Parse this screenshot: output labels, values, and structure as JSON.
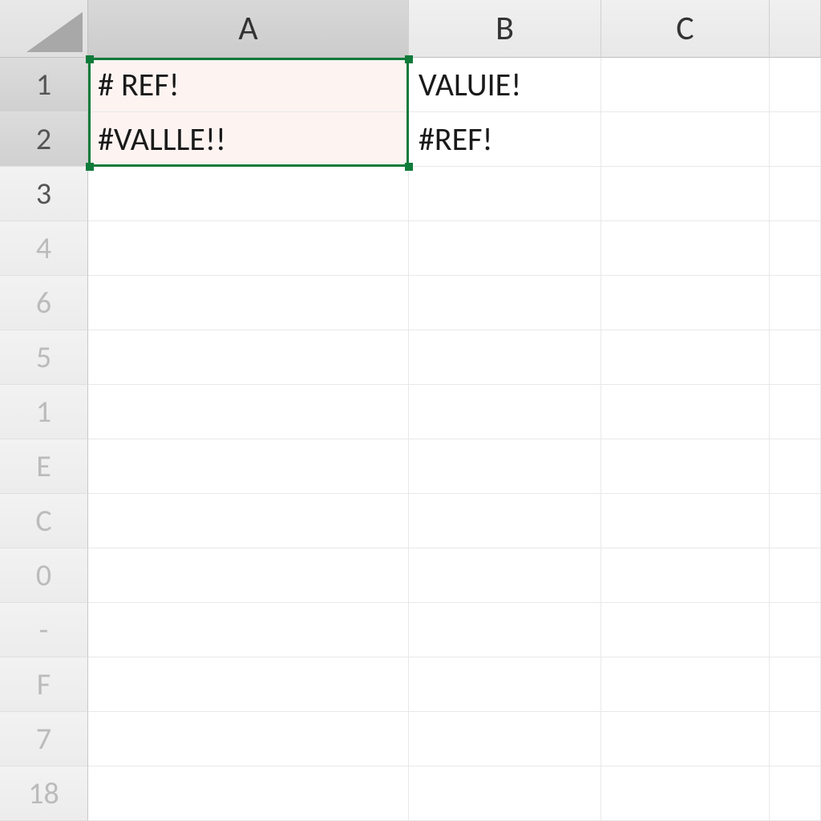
{
  "columns": [
    "A",
    "B",
    "C",
    ""
  ],
  "rows": [
    "1",
    "2",
    "3",
    "4",
    "6",
    "5",
    "1",
    "E",
    "C",
    "0",
    "-",
    "F",
    "7",
    "18"
  ],
  "cells": {
    "A1": "#  REF!",
    "A2": "#VALLLE!!",
    "B1": "VALUIE!",
    "B2": "#REF!"
  },
  "selection": {
    "range": "A1:A2",
    "color": "#0f7b3a"
  },
  "row_header_selected": [
    0,
    1
  ],
  "col_header_selected": [
    0
  ],
  "row_header_faded": [
    3,
    4,
    5,
    6,
    7,
    8,
    9,
    10,
    11,
    12,
    13
  ]
}
